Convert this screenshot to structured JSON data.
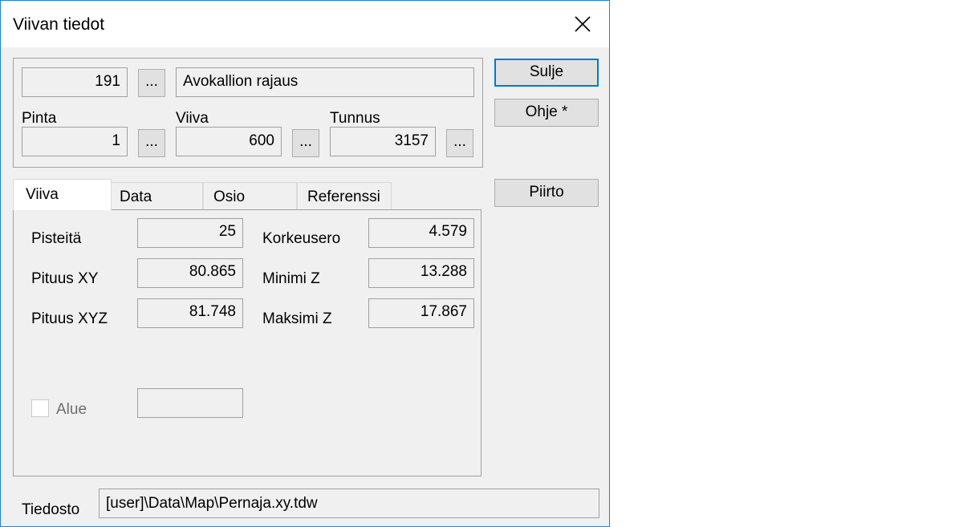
{
  "dialog": {
    "title": "Viivan tiedot",
    "close_icon": "close-x-icon"
  },
  "header": {
    "number": "191",
    "number_browse": "...",
    "name": "Avokallion rajaus",
    "pinta_label": "Pinta",
    "pinta_value": "1",
    "pinta_browse": "...",
    "viiva_label": "Viiva",
    "viiva_value": "600",
    "viiva_browse": "...",
    "tunnus_label": "Tunnus",
    "tunnus_value": "3157",
    "tunnus_browse": "..."
  },
  "buttons": {
    "sulje": "Sulje",
    "ohje": "Ohje *",
    "piirto": "Piirto"
  },
  "tabs": [
    {
      "label": "Viiva",
      "active": true
    },
    {
      "label": "Data",
      "active": false
    },
    {
      "label": "Osio",
      "active": false
    },
    {
      "label": "Referenssi",
      "active": false
    }
  ],
  "viiva_tab": {
    "pisteita_label": "Pisteitä",
    "pisteita_value": "25",
    "pituus_xy_label": "Pituus XY",
    "pituus_xy_value": "80.865",
    "pituus_xyz_label": "Pituus XYZ",
    "pituus_xyz_value": "81.748",
    "korkeusero_label": "Korkeusero",
    "korkeusero_value": "4.579",
    "minimi_z_label": "Minimi Z",
    "minimi_z_value": "13.288",
    "maksimi_z_label": "Maksimi Z",
    "maksimi_z_value": "17.867",
    "alue_label": "Alue",
    "alue_checked": false,
    "alue_value": ""
  },
  "file": {
    "label": "Tiedosto",
    "path": "[user]\\Data\\Map\\Pernaja.xy.tdw"
  },
  "colors": {
    "accent_border": "#1883d7",
    "default_button_border": "#0078d7",
    "dialog_bg": "#f0f0f0"
  }
}
